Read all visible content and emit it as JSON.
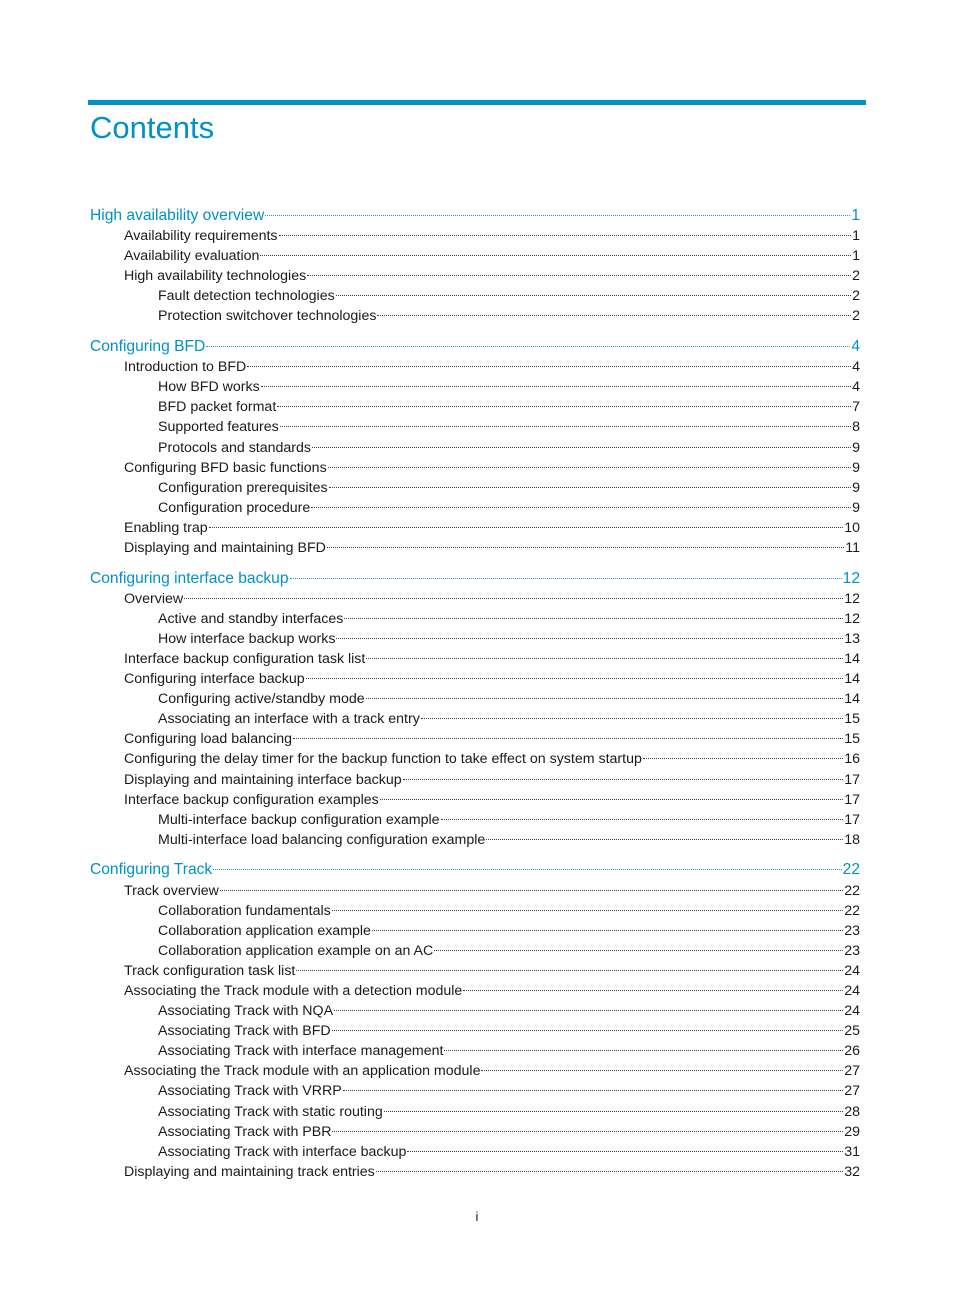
{
  "document": {
    "title": "Contents",
    "page_number": "i",
    "accent_color": "#0091c8"
  },
  "toc": [
    {
      "title": "High availability overview",
      "page": "1",
      "children": [
        {
          "title": "Availability requirements",
          "page": "1",
          "children": []
        },
        {
          "title": "Availability evaluation",
          "page": "1",
          "children": []
        },
        {
          "title": "High availability technologies",
          "page": "2",
          "children": [
            {
              "title": "Fault detection technologies",
              "page": "2"
            },
            {
              "title": "Protection switchover technologies",
              "page": "2"
            }
          ]
        }
      ]
    },
    {
      "title": "Configuring BFD",
      "page": "4",
      "children": [
        {
          "title": "Introduction to BFD",
          "page": "4",
          "children": [
            {
              "title": "How BFD works",
              "page": "4"
            },
            {
              "title": "BFD packet format",
              "page": "7"
            },
            {
              "title": "Supported features",
              "page": "8"
            },
            {
              "title": "Protocols and standards",
              "page": "9"
            }
          ]
        },
        {
          "title": "Configuring BFD basic functions",
          "page": "9",
          "children": [
            {
              "title": "Configuration prerequisites",
              "page": "9"
            },
            {
              "title": "Configuration procedure",
              "page": "9"
            }
          ]
        },
        {
          "title": "Enabling trap",
          "page": "10",
          "children": []
        },
        {
          "title": "Displaying and maintaining BFD",
          "page": "11",
          "children": []
        }
      ]
    },
    {
      "title": "Configuring interface backup",
      "page": "12",
      "children": [
        {
          "title": "Overview",
          "page": "12",
          "children": [
            {
              "title": "Active and standby interfaces",
              "page": "12"
            },
            {
              "title": "How interface backup works",
              "page": "13"
            }
          ]
        },
        {
          "title": "Interface backup configuration task list",
          "page": "14",
          "children": []
        },
        {
          "title": "Configuring interface backup",
          "page": "14",
          "children": [
            {
              "title": "Configuring active/standby mode",
              "page": "14"
            },
            {
              "title": "Associating an interface with a track entry",
              "page": "15"
            }
          ]
        },
        {
          "title": "Configuring load balancing",
          "page": "15",
          "children": []
        },
        {
          "title": "Configuring the delay timer for the backup function to take effect on system startup",
          "page": "16",
          "children": []
        },
        {
          "title": "Displaying and maintaining interface backup",
          "page": "17",
          "children": []
        },
        {
          "title": "Interface backup configuration examples",
          "page": "17",
          "children": [
            {
              "title": "Multi-interface backup configuration example",
              "page": "17"
            },
            {
              "title": "Multi-interface load balancing configuration example",
              "page": "18"
            }
          ]
        }
      ]
    },
    {
      "title": "Configuring Track",
      "page": "22",
      "children": [
        {
          "title": "Track overview",
          "page": "22",
          "children": [
            {
              "title": "Collaboration fundamentals",
              "page": "22"
            },
            {
              "title": "Collaboration application example",
              "page": "23"
            },
            {
              "title": "Collaboration application example on an AC",
              "page": "23"
            }
          ]
        },
        {
          "title": "Track configuration task list",
          "page": "24",
          "children": []
        },
        {
          "title": "Associating the Track module with a detection module",
          "page": "24",
          "children": [
            {
              "title": "Associating Track with NQA",
              "page": "24"
            },
            {
              "title": "Associating Track with BFD",
              "page": "25"
            },
            {
              "title": "Associating Track with interface management",
              "page": "26"
            }
          ]
        },
        {
          "title": "Associating the Track module with an application module",
          "page": "27",
          "children": [
            {
              "title": "Associating Track with VRRP",
              "page": "27"
            },
            {
              "title": "Associating Track with static routing",
              "page": "28"
            },
            {
              "title": "Associating Track with PBR",
              "page": "29"
            },
            {
              "title": "Associating Track with interface backup",
              "page": "31"
            }
          ]
        },
        {
          "title": "Displaying and maintaining track entries",
          "page": "32",
          "children": []
        }
      ]
    }
  ]
}
